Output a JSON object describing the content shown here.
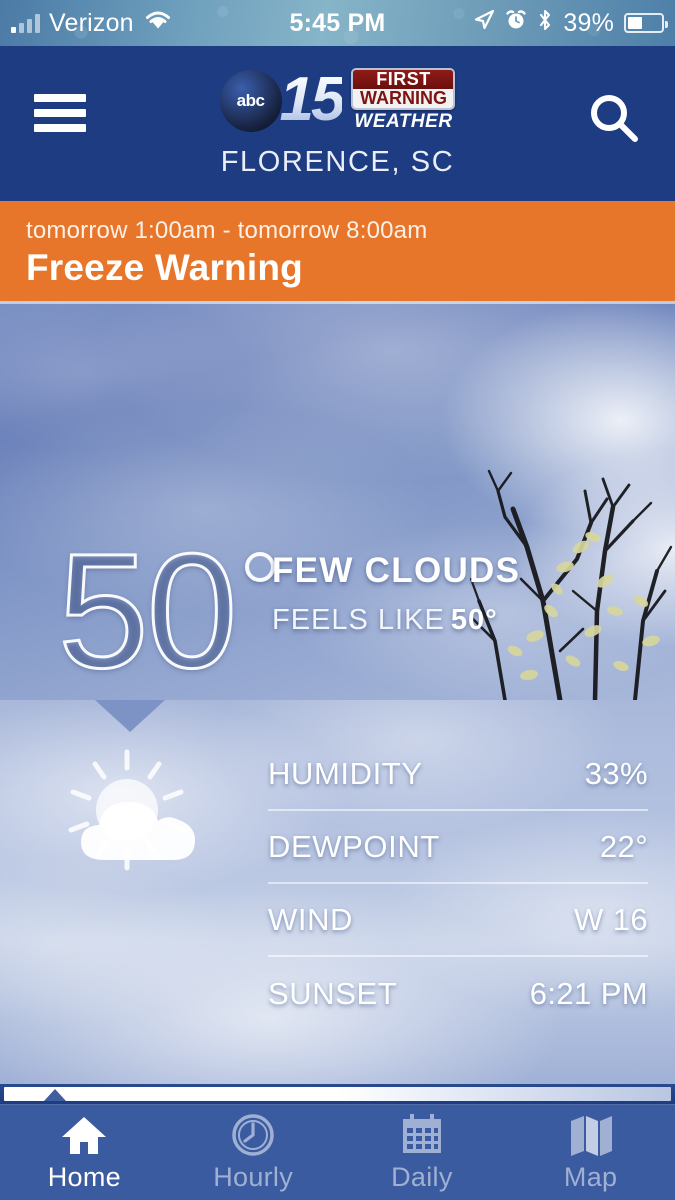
{
  "status_bar": {
    "carrier": "Verizon",
    "time": "5:45 PM",
    "battery_percent": "39%",
    "icons": [
      "signal-bars-icon",
      "wifi-icon",
      "location-arrow-icon",
      "alarm-clock-icon",
      "bluetooth-icon",
      "battery-icon"
    ]
  },
  "header": {
    "menu_icon": "hamburger-menu-icon",
    "search_icon": "search-icon",
    "logo": {
      "network": "abc",
      "channel": "15",
      "badge_line1": "FIRST",
      "badge_line2": "WARNING",
      "badge_line3": "WEATHER"
    },
    "city": "FLORENCE, SC"
  },
  "alert": {
    "time_range": "tomorrow 1:00am - tomorrow 8:00am",
    "title": "Freeze Warning",
    "color": "#e8762a"
  },
  "current": {
    "temperature": "50",
    "degree_symbol": "°",
    "condition": "FEW CLOUDS",
    "feels_like_label": "FEELS LIKE",
    "feels_like_value": "50°",
    "icon": "sun-behind-cloud-icon"
  },
  "details": [
    {
      "label": "HUMIDITY",
      "value": "33%"
    },
    {
      "label": "DEWPOINT",
      "value": "22°"
    },
    {
      "label": "WIND",
      "value": "W 16"
    },
    {
      "label": "SUNSET",
      "value": "6:21 PM"
    }
  ],
  "bottom_nav": [
    {
      "label": "Home",
      "icon": "home-icon",
      "active": true
    },
    {
      "label": "Hourly",
      "icon": "clock-icon",
      "active": false
    },
    {
      "label": "Daily",
      "icon": "calendar-icon",
      "active": false
    },
    {
      "label": "Map",
      "icon": "map-icon",
      "active": false
    }
  ],
  "theme": {
    "header_blue": "#1d3c82",
    "alert_orange": "#e8762a",
    "nav_blue": "#3a5ba0"
  }
}
